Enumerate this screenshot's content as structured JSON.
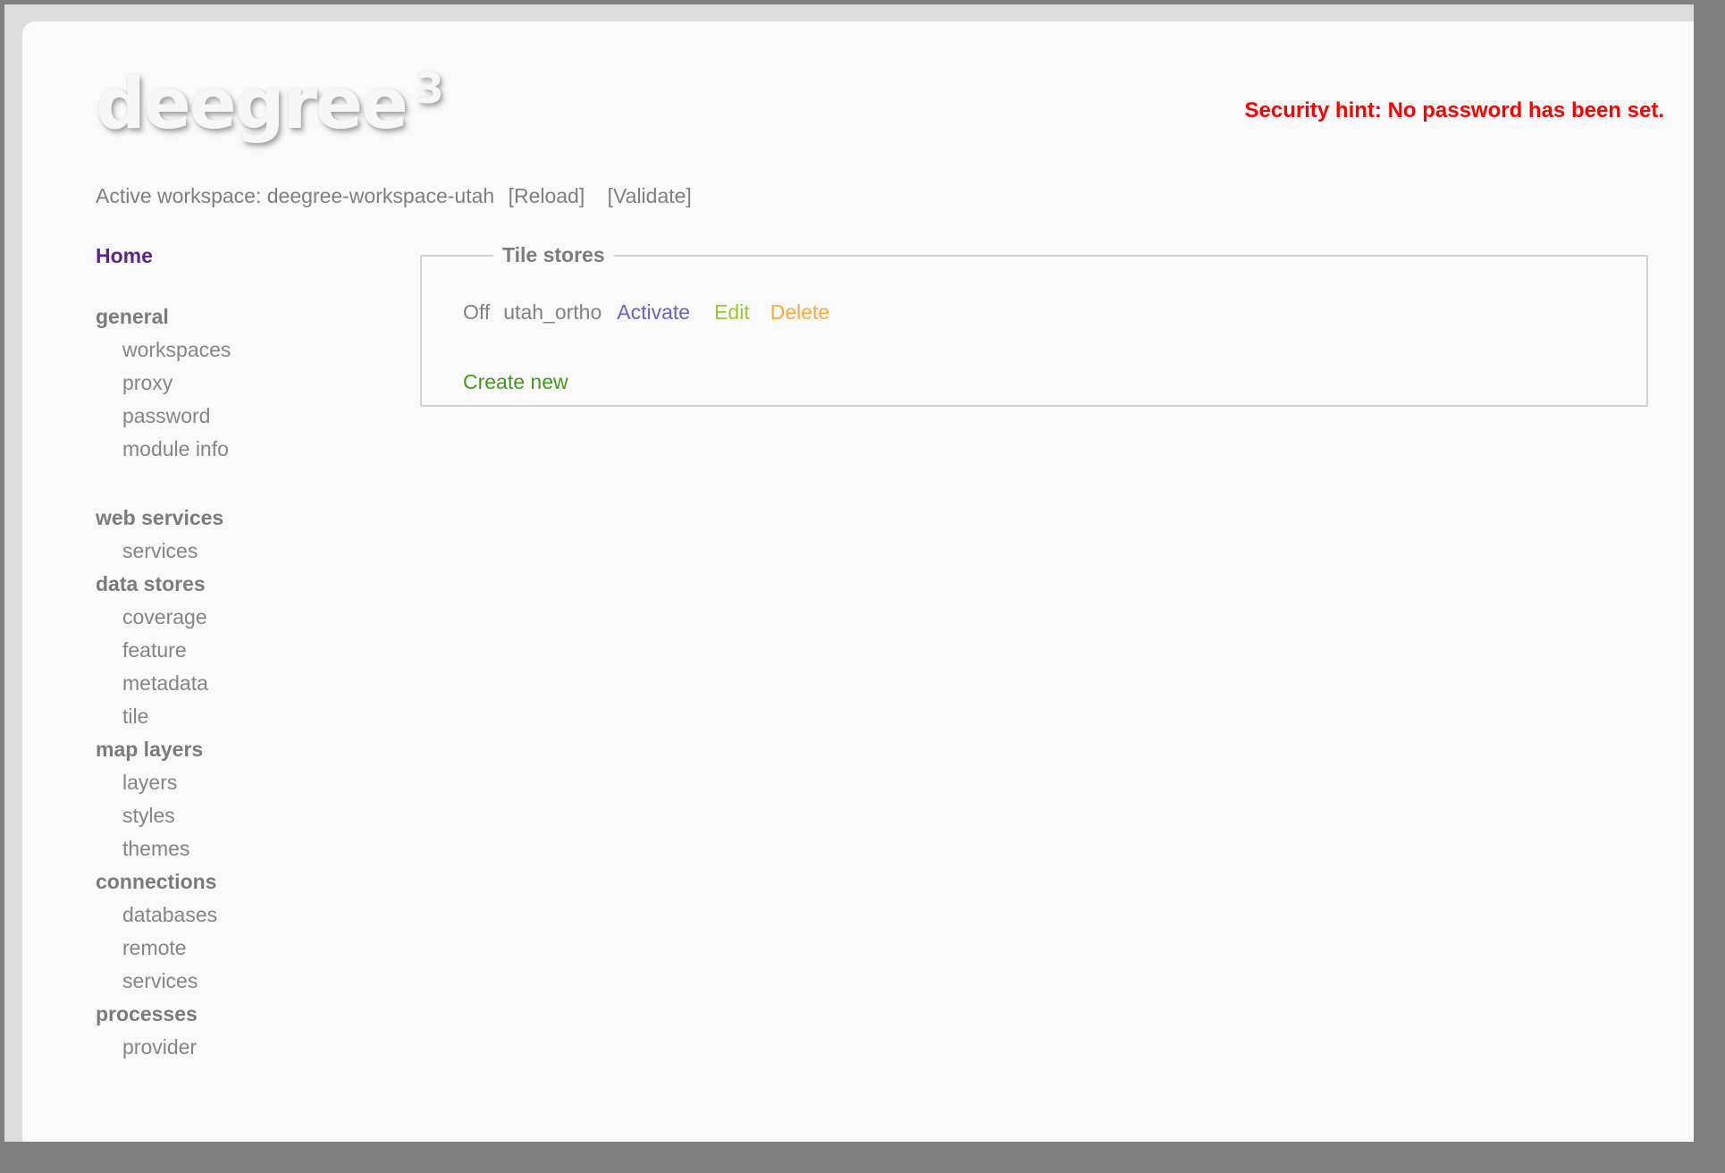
{
  "header": {
    "logo": "deegree",
    "logo_version": "3",
    "security_hint": "Security hint: No password has been set.",
    "workspace": {
      "label": "Active workspace: deegree-workspace-utah",
      "reload": "[Reload]",
      "validate": "[Validate]"
    }
  },
  "sidebar": {
    "items": [
      {
        "label": "Home",
        "type": "home"
      },
      {
        "label": "general",
        "type": "header"
      },
      {
        "label": "workspaces",
        "type": "item"
      },
      {
        "label": "proxy",
        "type": "item"
      },
      {
        "label": "password",
        "type": "item"
      },
      {
        "label": "module info",
        "type": "item"
      },
      {
        "label": "web services",
        "type": "header"
      },
      {
        "label": "services",
        "type": "item"
      },
      {
        "label": "data stores",
        "type": "header"
      },
      {
        "label": "coverage",
        "type": "item"
      },
      {
        "label": "feature",
        "type": "item"
      },
      {
        "label": "metadata",
        "type": "item"
      },
      {
        "label": "tile",
        "type": "item"
      },
      {
        "label": "map layers",
        "type": "header"
      },
      {
        "label": "layers",
        "type": "item"
      },
      {
        "label": "styles",
        "type": "item"
      },
      {
        "label": "themes",
        "type": "item"
      },
      {
        "label": "connections",
        "type": "header"
      },
      {
        "label": "databases",
        "type": "item"
      },
      {
        "label": "remote",
        "type": "item"
      },
      {
        "label": "services",
        "type": "item"
      },
      {
        "label": "processes",
        "type": "header"
      },
      {
        "label": "provider",
        "type": "item"
      }
    ]
  },
  "main": {
    "legend": "Tile stores",
    "tile_store": {
      "status": "Off",
      "name": "utah_ortho",
      "activate": "Activate",
      "edit": "Edit",
      "delete": "Delete"
    },
    "create_new": "Create new"
  },
  "colors": {
    "home_link": "#5b2491",
    "activate_link": "#6363cf",
    "edit_link": "#96cb28",
    "delete_link": "#fbaa38",
    "create_new_link": "#3f9a1c",
    "security_hint": "#fd0000",
    "text_gray": "#828282",
    "frame_outer": "#808080",
    "frame_inner": "#dcdcdc",
    "page_background": "#fafafa"
  }
}
